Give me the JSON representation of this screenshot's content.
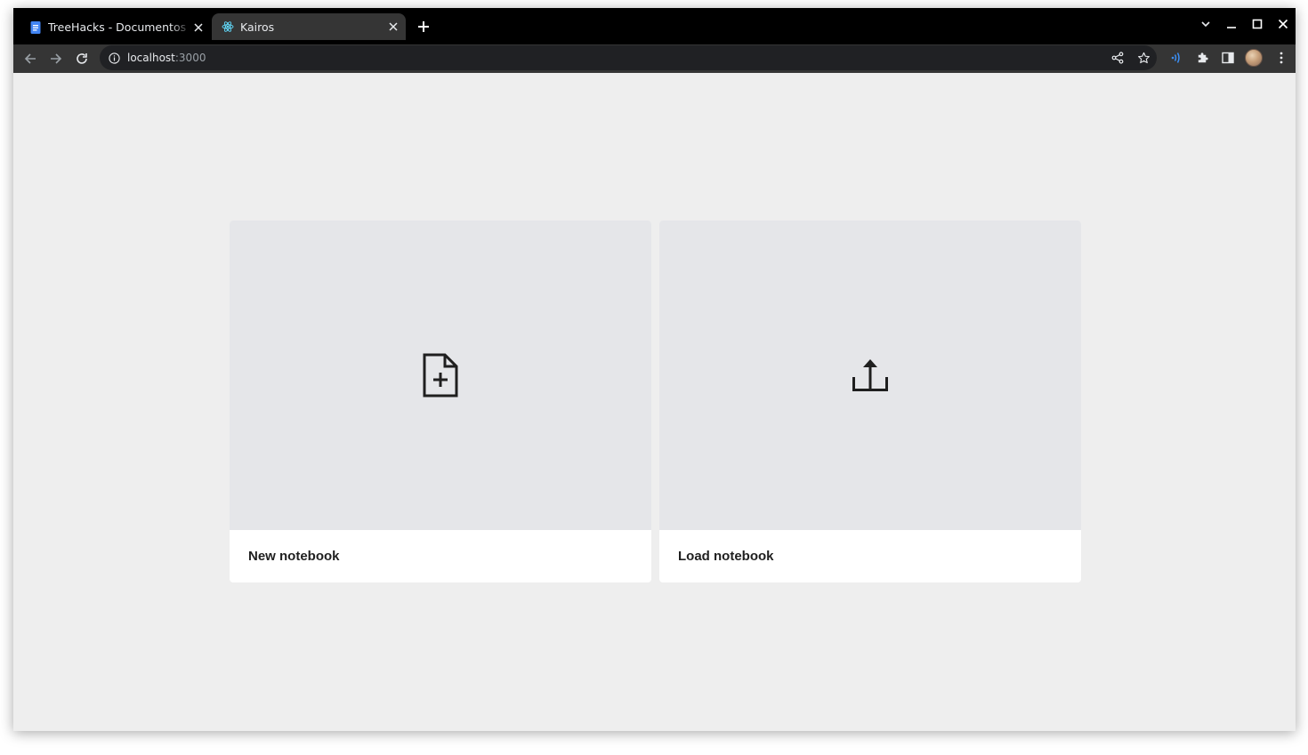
{
  "browser": {
    "tabs": [
      {
        "title": "TreeHacks - Documentos de Google",
        "favicon": "google-docs-icon",
        "active": false
      },
      {
        "title": "Kairos",
        "favicon": "react-icon",
        "active": true
      }
    ],
    "address_bar": {
      "host": "localhost",
      "port": ":3000"
    },
    "colors": {
      "tabstrip": "#000000",
      "toolbar": "#353535",
      "omnibox": "#202124"
    }
  },
  "page": {
    "cards": [
      {
        "label": "New notebook",
        "icon": "file-plus-icon"
      },
      {
        "label": "Load notebook",
        "icon": "upload-icon"
      }
    ],
    "colors": {
      "background": "#eeeeee",
      "card_media": "#e5e6e9",
      "card": "#ffffff"
    }
  }
}
